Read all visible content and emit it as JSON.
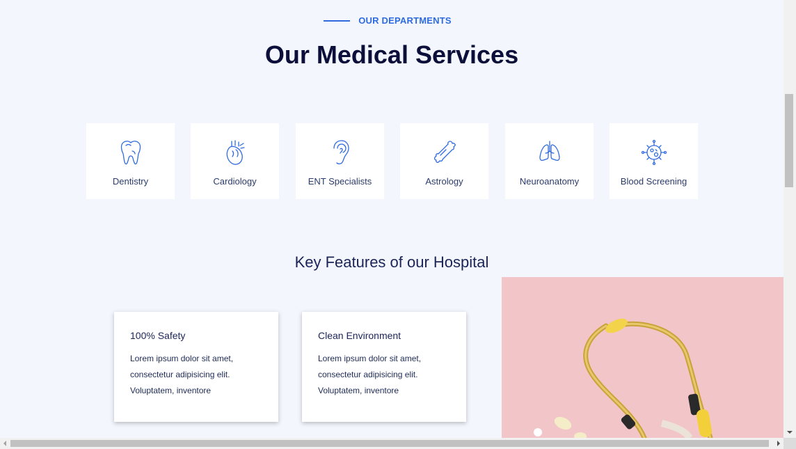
{
  "header": {
    "eyebrow": "OUR DEPARTMENTS",
    "title": "Our Medical Services"
  },
  "services": [
    {
      "label": "Dentistry",
      "icon": "tooth-icon"
    },
    {
      "label": "Cardiology",
      "icon": "heart-organ-icon"
    },
    {
      "label": "ENT Specialists",
      "icon": "ear-icon"
    },
    {
      "label": "Astrology",
      "icon": "bone-icon"
    },
    {
      "label": "Neuroanatomy",
      "icon": "lungs-icon"
    },
    {
      "label": "Blood Screening",
      "icon": "virus-icon"
    }
  ],
  "features": {
    "title": "Key Features of our Hospital",
    "cards": [
      {
        "title": "100% Safety",
        "text": "Lorem ipsum dolor sit amet, consectetur adipisicing elit. Voluptatem, inventore"
      },
      {
        "title": "Clean Environment",
        "text": "Lorem ipsum dolor sit amet, consectetur adipisicing elit. Voluptatem, inventore"
      }
    ],
    "image": "stethoscope-photo"
  },
  "colors": {
    "accent": "#2f6be0",
    "heading": "#0b0f3a",
    "background": "#f3f7fd",
    "photo_background": "#f2c5c8"
  }
}
